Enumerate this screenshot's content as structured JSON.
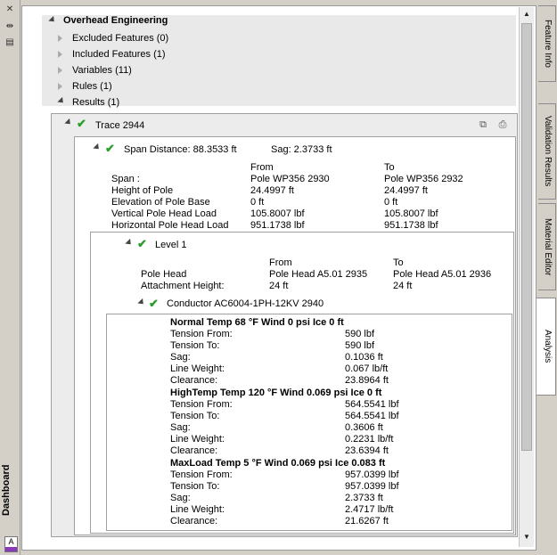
{
  "window": {
    "title": "Dashboard",
    "badge": "A"
  },
  "left_toolbar": {
    "icons": [
      "close-icon",
      "pin-icon",
      "properties-icon"
    ]
  },
  "tabs": [
    {
      "label": "Feature Info",
      "active": false
    },
    {
      "label": "Validation Results",
      "active": false
    },
    {
      "label": "Material Editor",
      "active": false
    },
    {
      "label": "Analysis",
      "active": true
    }
  ],
  "tree": {
    "root": "Overhead Engineering",
    "items": [
      "Excluded Features (0)",
      "Included Features (1)",
      "Variables (11)",
      "Rules (1)",
      "Results (1)"
    ]
  },
  "trace": {
    "label": "Trace 2944"
  },
  "span": {
    "header": "Span Distance: 88.3533 ft",
    "sag": "Sag: 2.3733 ft",
    "col_from": "From",
    "col_to": "To",
    "rows": [
      {
        "label": "Span :",
        "from": "Pole WP356 2930",
        "to": "Pole WP356 2932"
      },
      {
        "label": "Height of Pole",
        "from": "24.4997 ft",
        "to": "24.4997 ft"
      },
      {
        "label": "Elevation of Pole Base",
        "from": "0 ft",
        "to": "0 ft"
      },
      {
        "label": "Vertical Pole Head Load",
        "from": "105.8007 lbf",
        "to": "105.8007 lbf"
      },
      {
        "label": "Horizontal Pole Head Load",
        "from": "951.1738 lbf",
        "to": "951.1738 lbf"
      }
    ]
  },
  "level": {
    "label": "Level 1",
    "col_from": "From",
    "col_to": "To",
    "rows": [
      {
        "label": "Pole Head",
        "from": "Pole Head A5.01 2935",
        "to": "Pole Head A5.01 2936"
      },
      {
        "label": "Attachment Height:",
        "from": "24 ft",
        "to": "24 ft"
      }
    ]
  },
  "conductor": {
    "label": "Conductor AC6004-1PH-12KV 2940",
    "conditions": [
      {
        "title": "Normal Temp 68 °F Wind 0 psi Ice 0 ft",
        "rows": [
          {
            "label": "Tension From:",
            "value": "590 lbf"
          },
          {
            "label": "Tension To:",
            "value": "590 lbf"
          },
          {
            "label": "Sag:",
            "value": "0.1036 ft"
          },
          {
            "label": "Line Weight:",
            "value": "0.067 lb/ft"
          },
          {
            "label": "Clearance:",
            "value": "23.8964 ft"
          }
        ]
      },
      {
        "title": "HighTemp Temp 120 °F Wind 0.069 psi Ice 0 ft",
        "rows": [
          {
            "label": "Tension From:",
            "value": "564.5541 lbf"
          },
          {
            "label": "Tension To:",
            "value": "564.5541 lbf"
          },
          {
            "label": "Sag:",
            "value": "0.3606 ft"
          },
          {
            "label": "Line Weight:",
            "value": "0.2231 lb/ft"
          },
          {
            "label": "Clearance:",
            "value": "23.6394 ft"
          }
        ]
      },
      {
        "title": "MaxLoad Temp 5 °F Wind 0.069 psi Ice 0.083 ft",
        "rows": [
          {
            "label": "Tension From:",
            "value": "957.0399 lbf"
          },
          {
            "label": "Tension To:",
            "value": "957.0399 lbf"
          },
          {
            "label": "Sag:",
            "value": "2.3733 ft"
          },
          {
            "label": "Line Weight:",
            "value": "2.4717 lb/ft"
          },
          {
            "label": "Clearance:",
            "value": "21.6267 ft"
          }
        ]
      }
    ]
  }
}
